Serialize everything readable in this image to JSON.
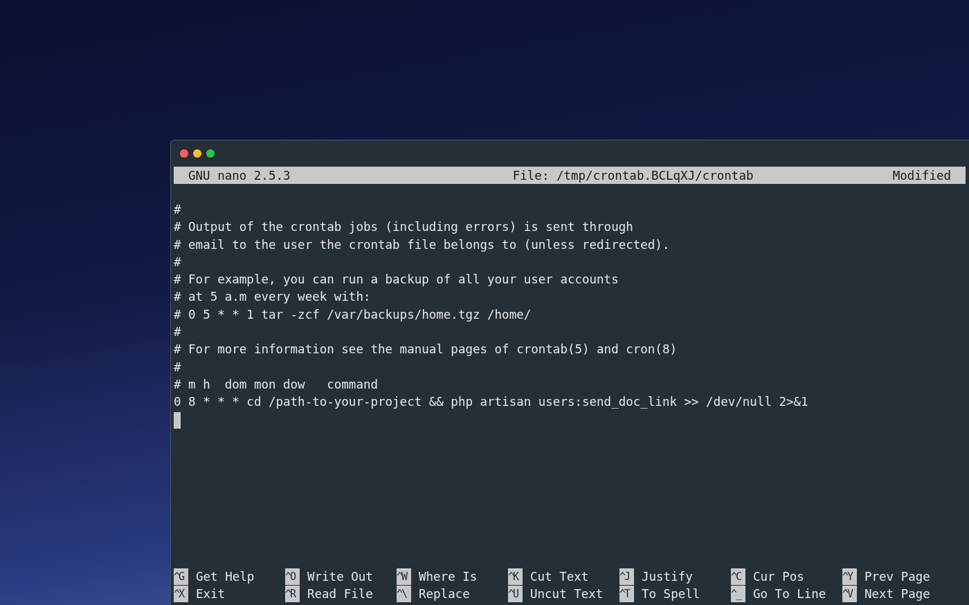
{
  "header": {
    "app": "GNU nano 2.5.3",
    "file": "File: /tmp/crontab.BCLqXJ/crontab",
    "status": "Modified"
  },
  "lines": [
    "#",
    "# Output of the crontab jobs (including errors) is sent through",
    "# email to the user the crontab file belongs to (unless redirected).",
    "#",
    "# For example, you can run a backup of all your user accounts",
    "# at 5 a.m every week with:",
    "# 0 5 * * 1 tar -zcf /var/backups/home.tgz /home/",
    "#",
    "# For more information see the manual pages of crontab(5) and cron(8)",
    "#",
    "# m h  dom mon dow   command",
    "0 8 * * * cd /path-to-your-project && php artisan users:send_doc_link >> /dev/null 2>&1"
  ],
  "shortcuts": [
    {
      "key": "^G",
      "label": "Get Help"
    },
    {
      "key": "^X",
      "label": "Exit"
    },
    {
      "key": "^O",
      "label": "Write Out"
    },
    {
      "key": "^R",
      "label": "Read File"
    },
    {
      "key": "^W",
      "label": "Where Is"
    },
    {
      "key": "^\\",
      "label": "Replace"
    },
    {
      "key": "^K",
      "label": "Cut Text"
    },
    {
      "key": "^U",
      "label": "Uncut Text"
    },
    {
      "key": "^J",
      "label": "Justify"
    },
    {
      "key": "^T",
      "label": "To Spell"
    },
    {
      "key": "^C",
      "label": "Cur Pos"
    },
    {
      "key": "^_",
      "label": "Go To Line"
    },
    {
      "key": "^Y",
      "label": "Prev Page"
    },
    {
      "key": "^V",
      "label": "Next Page"
    }
  ]
}
